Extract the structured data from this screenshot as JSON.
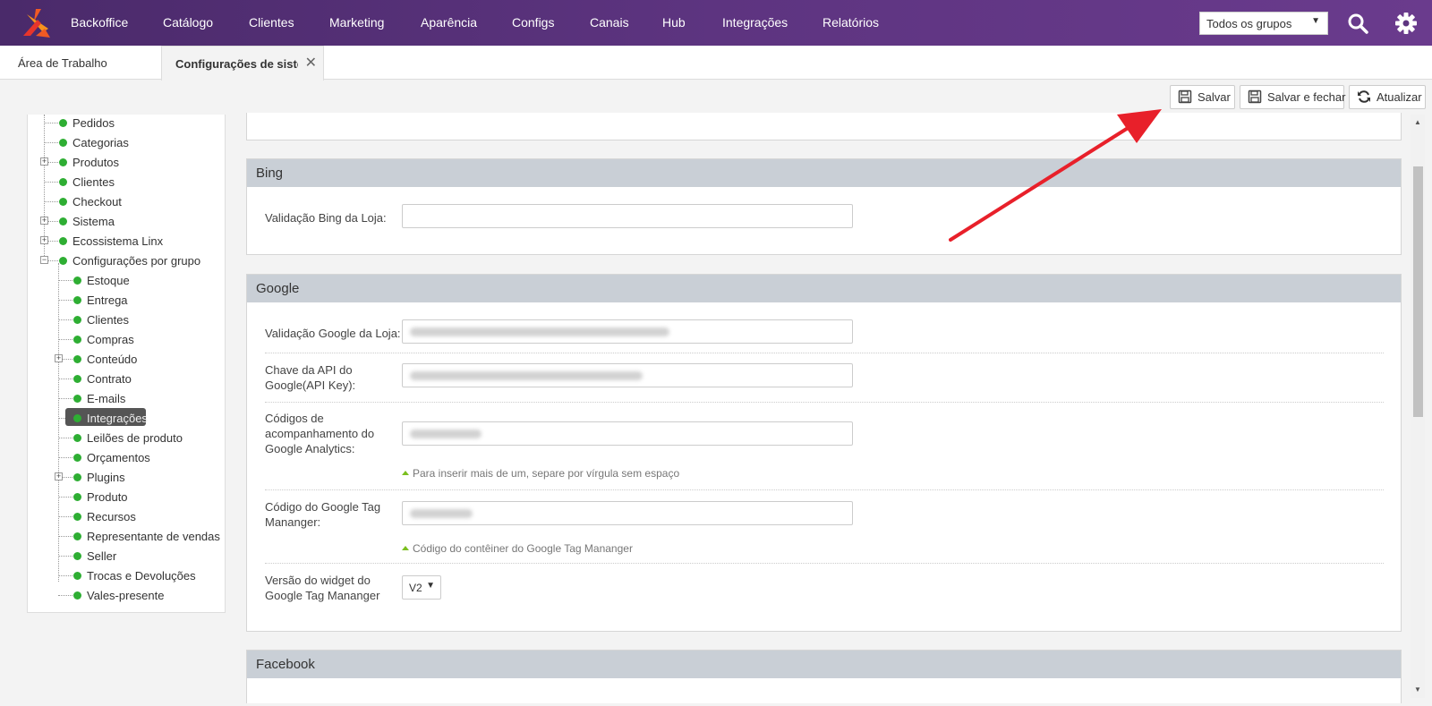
{
  "topnav": {
    "items": [
      "Backoffice",
      "Catálogo",
      "Clientes",
      "Marketing",
      "Aparência",
      "Configs",
      "Canais",
      "Hub",
      "Integrações",
      "Relatórios"
    ],
    "group_select": "Todos os grupos",
    "brand_color": "#5d3480"
  },
  "tabs": {
    "home": "Área de Trabalho",
    "active": "Configurações de sistema"
  },
  "toolbar": {
    "save": "Salvar",
    "save_close": "Salvar e fechar",
    "refresh": "Atualizar"
  },
  "sidebar": {
    "items": [
      "Pedidos",
      "Categorias",
      "Produtos",
      "Clientes",
      "Checkout",
      "Sistema",
      "Ecossistema Linx",
      "Configurações por grupo",
      "Estoque",
      "Entrega",
      "Clientes",
      "Compras",
      "Conteúdo",
      "Contrato",
      "E-mails",
      "Integrações",
      "Leilões de produto",
      "Orçamentos",
      "Plugins",
      "Produto",
      "Recursos",
      "Representante de vendas",
      "Seller",
      "Trocas e Devoluções",
      "Vales-presente"
    ],
    "selected": "Integrações",
    "status_color": "#2eae33"
  },
  "bing": {
    "title": "Bing",
    "validation_label": "Validação Bing da Loja:",
    "validation_value": ""
  },
  "google": {
    "title": "Google",
    "validation_label": "Validação Google da Loja:",
    "api_key_label": "Chave da API do Google(API Key):",
    "analytics_label": "Códigos de acompanhamento do Google Analytics:",
    "analytics_hint": "Para inserir mais de um, separe por vírgula sem espaço",
    "gtm_label": "Código do Google Tag Mananger:",
    "gtm_hint": "Código do contêiner do Google Tag Mananger",
    "widget_label": "Versão do widget do Google Tag Mananger",
    "widget_value": "V2"
  },
  "facebook": {
    "title": "Facebook"
  }
}
